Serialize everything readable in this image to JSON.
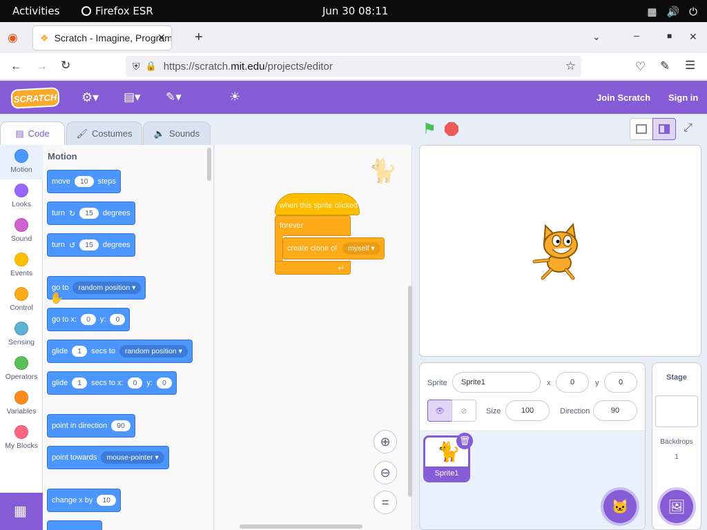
{
  "system": {
    "activities": "Activities",
    "app": "Firefox ESR",
    "clock": "Jun 30  08:11"
  },
  "browser": {
    "tab_title": "Scratch - Imagine, Program, Share",
    "url_prefix": "https://scratch.",
    "url_domain": "mit.edu",
    "url_path": "/projects/editor"
  },
  "header": {
    "logo": "SCRATCH",
    "join": "Join Scratch",
    "signin": "Sign in"
  },
  "tabs": {
    "code": "Code",
    "costumes": "Costumes",
    "sounds": "Sounds"
  },
  "categories": [
    {
      "label": "Motion",
      "color": "#4c97ff"
    },
    {
      "label": "Looks",
      "color": "#9966ff"
    },
    {
      "label": "Sound",
      "color": "#cf63cf"
    },
    {
      "label": "Events",
      "color": "#ffbf00"
    },
    {
      "label": "Control",
      "color": "#ffab19"
    },
    {
      "label": "Sensing",
      "color": "#5cb1d6"
    },
    {
      "label": "Operators",
      "color": "#59c059"
    },
    {
      "label": "Variables",
      "color": "#ff8c1a"
    },
    {
      "label": "My Blocks",
      "color": "#ff6680"
    }
  ],
  "palette": {
    "title": "Motion",
    "move": {
      "a": "move",
      "v": "10",
      "b": "steps"
    },
    "turn_right": {
      "a": "turn",
      "v": "15",
      "b": "degrees"
    },
    "turn_left": {
      "a": "turn",
      "v": "15",
      "b": "degrees"
    },
    "goto": {
      "a": "go to",
      "dd": "random position"
    },
    "gotoxy": {
      "a": "go to x:",
      "x": "0",
      "b": "y:",
      "y": "0"
    },
    "glide_to": {
      "a": "glide",
      "v": "1",
      "b": "secs to",
      "dd": "random position"
    },
    "glide_xy": {
      "a": "glide",
      "v": "1",
      "b": "secs to x:",
      "x": "0",
      "c": "y:",
      "y": "0"
    },
    "point_dir": {
      "a": "point in direction",
      "v": "90"
    },
    "point_towards": {
      "a": "point towards",
      "dd": "mouse-pointer"
    },
    "change_x": {
      "a": "change x by",
      "v": "10"
    }
  },
  "script": {
    "hat": "when this sprite clicked",
    "forever": "forever",
    "clone": "create clone of",
    "clone_target": "myself"
  },
  "sprite": {
    "label": "Sprite",
    "name": "Sprite1",
    "x_label": "x",
    "x": "0",
    "y_label": "y",
    "y": "0",
    "size_label": "Size",
    "size": "100",
    "dir_label": "Direction",
    "direction": "90",
    "thumb_name": "Sprite1"
  },
  "stage_panel": {
    "title": "Stage",
    "backdrops_label": "Backdrops",
    "backdrops_count": "1"
  },
  "colors": {
    "purple": "#855cd6",
    "motion": "#4c97ff",
    "control": "#ffab19"
  }
}
